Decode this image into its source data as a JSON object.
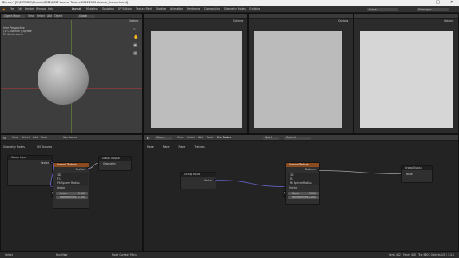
{
  "title_bar": {
    "text": "Blender* [E:\\ESTUDIO\\Blender\\2022\\2022 Voronoi Texture\\2022\\2022 Voronoi_Texture.blend]"
  },
  "menu": {
    "items": [
      "File",
      "Edit",
      "Render",
      "Window",
      "Help"
    ],
    "workspaces": [
      "Layout",
      "Modeling",
      "Sculpting",
      "UV Editing",
      "Texture Paint",
      "Shading",
      "Animation",
      "Rendering",
      "Compositing",
      "Geometry Nodes",
      "Scripting"
    ],
    "scene": "Scene",
    "view_layer": "ViewLayer"
  },
  "viewport": {
    "mode": "Object Mode",
    "menus": [
      "View",
      "Select",
      "Add",
      "Object"
    ],
    "global": "Global",
    "options": "Options",
    "info": [
      "User Perspective",
      "(1) Collection | Sphere",
      "51 Centimeters"
    ]
  },
  "image_editors": [
    {
      "options": "Options"
    },
    {
      "options": "Options"
    },
    {
      "options": "Options"
    }
  ],
  "left_nodes": {
    "menus": [
      "View",
      "Select",
      "Add",
      "Node"
    ],
    "use_nodes": "Use Nodes",
    "breadcrumb": [
      "Geometry Nodes",
      "GN Textures"
    ],
    "group_input": {
      "title": "Group Input",
      "socket": "Vector"
    },
    "voronoi": {
      "title": "Voronoi Texture",
      "out_socket": "Position",
      "dim": "3D",
      "feature": "F1",
      "distance": "Euclidean",
      "normalize": "Fit Sphere Radius",
      "vector": "Vector",
      "scale_label": "Scale",
      "scale": "5.000",
      "random_label": "Randomness",
      "random": "1.000"
    },
    "group_output": {
      "title": "Group Output",
      "socket": "Geometry"
    }
  },
  "right_nodes": {
    "menus": [
      "Object",
      "View",
      "Select",
      "Add",
      "Node"
    ],
    "use_nodes": "Use Nodes",
    "slot": "Slot 1",
    "material": "Material",
    "breadcrumb": [
      "Plane",
      "Plane",
      "Plane",
      "Textures"
    ],
    "group_input": {
      "title": "Group Input",
      "socket": "Vector"
    },
    "voronoi": {
      "title": "Voronoi Texture",
      "out_socket": "Distance",
      "dim": "3D",
      "feature": "F1",
      "distance": "Euclidean",
      "normalize": "Fit Sphere Radius",
      "vector": "Vector",
      "scale_label": "Scale",
      "scale": "5.000",
      "random_label": "Randomness",
      "random": "1.000"
    },
    "group_output": {
      "title": "Group Output",
      "socket": "Value"
    }
  },
  "status": {
    "left": "Select",
    "mid1": "Pan View",
    "mid2": "Node Context Menu",
    "right": "Verts 482 | Faces 480 | Tris 960 | Objects 0/1 | 3.4.0"
  },
  "colors": {
    "accent": "#4772b3",
    "texture_header": "#8c4a1f",
    "vector_link": "#6363c7"
  }
}
